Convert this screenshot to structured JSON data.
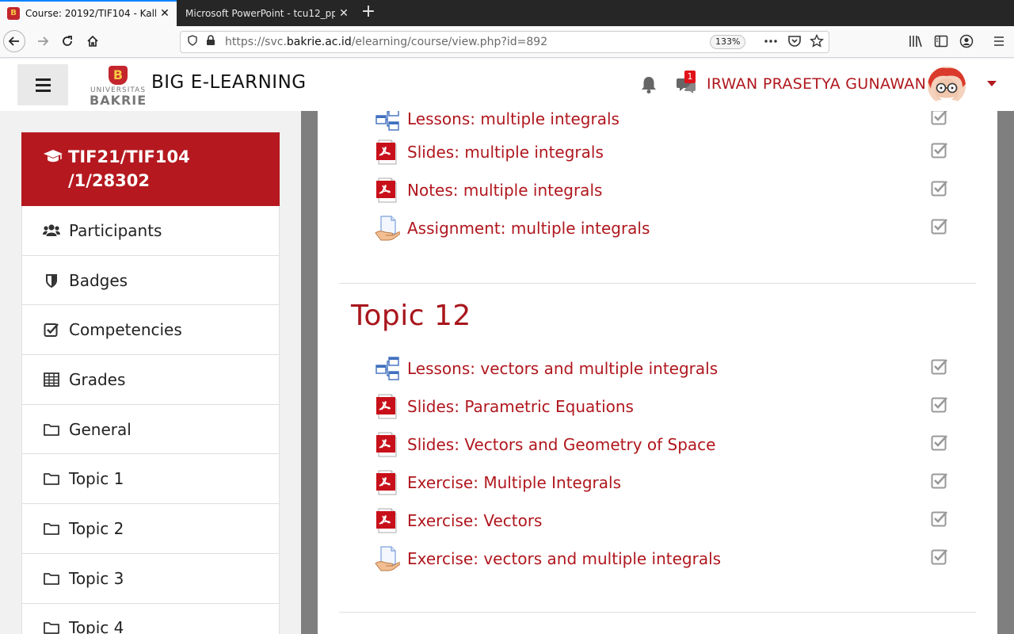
{
  "browser": {
    "tabs": [
      {
        "title": "Course: 20192/TIF104 - Kalku",
        "favicon": "bakrie-favicon",
        "active": true
      },
      {
        "title": "Microsoft PowerPoint - tcu12_ppt_",
        "active": false
      }
    ],
    "close_glyph": "✕",
    "newtab_glyph": "+",
    "url_scheme_host_prefix": "https://svc.",
    "url_host": "bakrie.ac.id",
    "url_path": "/elearning/course/view.php?id=892",
    "zoom": "133%",
    "accent": "#0a84ff"
  },
  "header": {
    "site_name": "BIG E-LEARNING",
    "logo_letter": "B",
    "logo_top": "UNIVERSITAS",
    "logo_bottom": "BAKRIE",
    "notification_count": "1",
    "user_name": "IRWAN PRASETYA GUNAWAN",
    "brand_color": "#b5191f"
  },
  "drawer": {
    "course_line1": "TIF21/TIF104",
    "course_line2": "/1/28302",
    "items": [
      {
        "label": "Participants",
        "icon": "users-icon"
      },
      {
        "label": "Badges",
        "icon": "shield-icon"
      },
      {
        "label": "Competencies",
        "icon": "check-square-icon"
      },
      {
        "label": "Grades",
        "icon": "table-icon"
      },
      {
        "label": "General",
        "icon": "folder-icon"
      },
      {
        "label": "Topic 1",
        "icon": "folder-icon"
      },
      {
        "label": "Topic 2",
        "icon": "folder-icon"
      },
      {
        "label": "Topic 3",
        "icon": "folder-icon"
      },
      {
        "label": "Topic 4",
        "icon": "folder-icon"
      }
    ]
  },
  "main": {
    "previous_activities": [
      {
        "label": "Lessons: multiple integrals",
        "icon": "lesson-icon",
        "completed": true
      },
      {
        "label": "Slides: multiple integrals",
        "icon": "pdf-icon",
        "completed": true
      },
      {
        "label": "Notes: multiple integrals",
        "icon": "pdf-icon",
        "completed": true
      },
      {
        "label": "Assignment: multiple integrals",
        "icon": "assignment-icon",
        "completed": true
      }
    ],
    "topic12": {
      "title": "Topic 12",
      "activities": [
        {
          "label": "Lessons: vectors and multiple integrals",
          "icon": "lesson-icon",
          "completed": true
        },
        {
          "label": "Slides: Parametric Equations",
          "icon": "pdf-icon",
          "completed": true
        },
        {
          "label": "Slides: Vectors and Geometry of Space",
          "icon": "pdf-icon",
          "completed": true
        },
        {
          "label": "Exercise: Multiple Integrals",
          "icon": "pdf-icon",
          "completed": true
        },
        {
          "label": "Exercise: Vectors",
          "icon": "pdf-icon",
          "completed": true
        },
        {
          "label": "Exercise: vectors and multiple integrals",
          "icon": "assignment-icon",
          "completed": true
        }
      ]
    },
    "link_color": "#b0171e"
  }
}
